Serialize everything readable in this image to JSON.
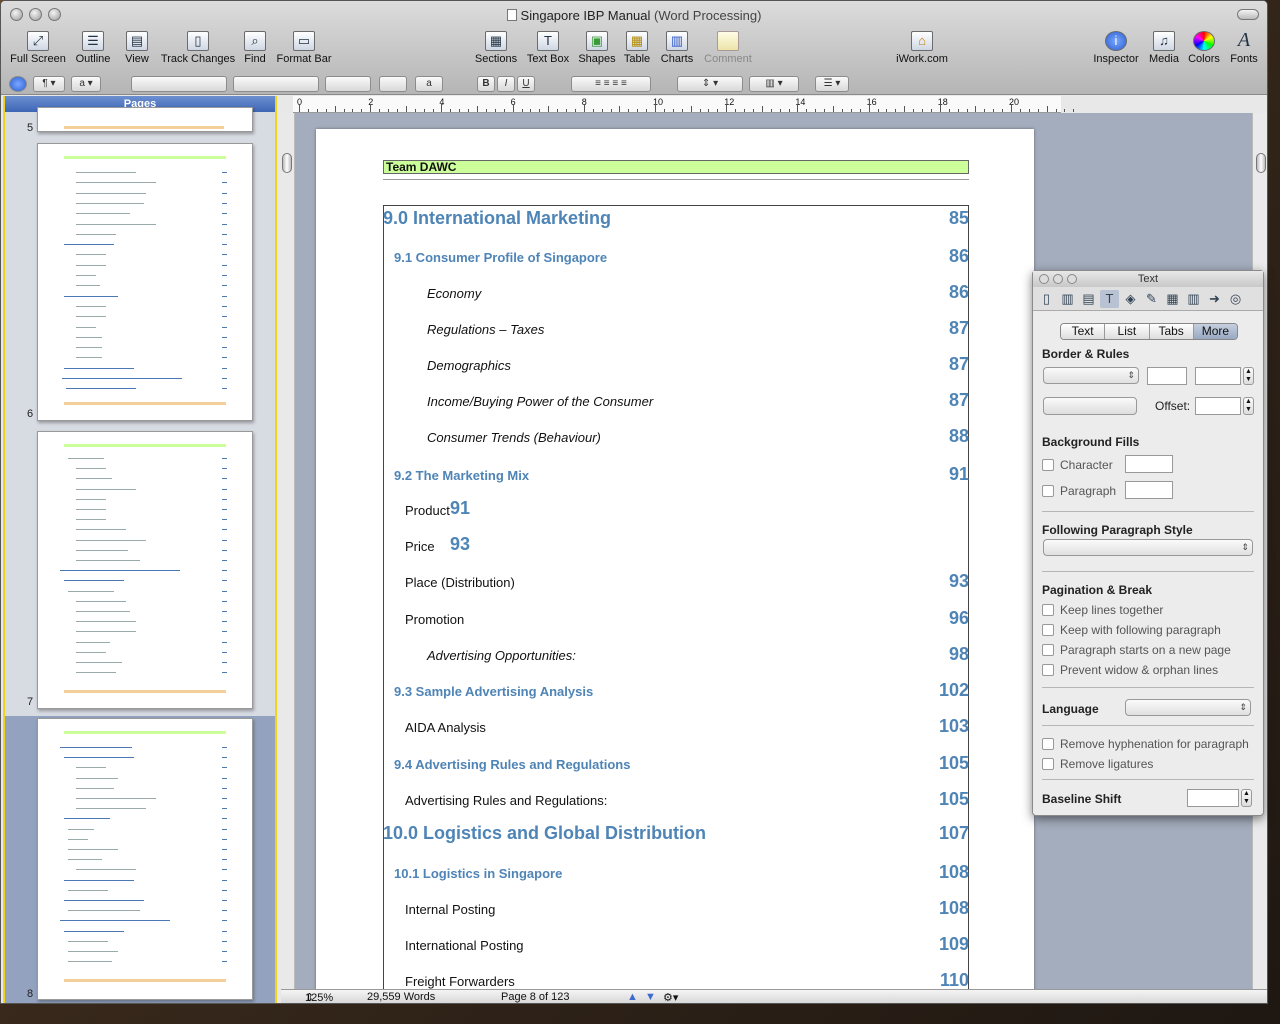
{
  "window": {
    "title": "Singapore IBP Manual",
    "subtitle": "(Word Processing)"
  },
  "toolbar": {
    "left": [
      {
        "label": "Full Screen",
        "icon": "full-screen-icon"
      },
      {
        "label": "Outline",
        "icon": "outline-icon"
      },
      {
        "label": "View",
        "icon": "view-icon"
      },
      {
        "label": "Track Changes",
        "icon": "track-changes-icon"
      },
      {
        "label": "Find",
        "icon": "find-icon"
      },
      {
        "label": "Format Bar",
        "icon": "format-bar-icon"
      }
    ],
    "center": [
      {
        "label": "Sections",
        "icon": "sections-icon"
      },
      {
        "label": "Text Box",
        "icon": "text-box-icon"
      },
      {
        "label": "Shapes",
        "icon": "shapes-icon"
      },
      {
        "label": "Table",
        "icon": "table-icon"
      },
      {
        "label": "Charts",
        "icon": "charts-icon"
      },
      {
        "label": "Comment",
        "icon": "comment-icon"
      }
    ],
    "iwork": {
      "label": "iWork.com",
      "icon": "iwork-icon"
    },
    "right": [
      {
        "label": "Inspector",
        "icon": "inspector-icon"
      },
      {
        "label": "Media",
        "icon": "media-icon"
      },
      {
        "label": "Colors",
        "icon": "colors-icon"
      },
      {
        "label": "Fonts",
        "icon": "fonts-icon"
      }
    ]
  },
  "formatbar": {
    "bold": "B",
    "italic": "I",
    "underline": "U",
    "a_glyph": "a"
  },
  "sidebar": {
    "header": "Pages",
    "page_numbers": [
      "5",
      "6",
      "7",
      "8"
    ]
  },
  "ruler": {
    "ticks": [
      "0",
      "2",
      "4",
      "6",
      "8",
      "10",
      "12",
      "14",
      "16",
      "18",
      "20"
    ]
  },
  "document": {
    "header": "Team DAWC",
    "toc": [
      {
        "level": "h1",
        "label": "9.0 International Marketing",
        "page": "85"
      },
      {
        "level": "h2",
        "label": "9.1 Consumer Profile of Singapore",
        "page": "86"
      },
      {
        "level": "h4",
        "label": "Economy",
        "page": "86"
      },
      {
        "level": "h4",
        "label": "Regulations – Taxes",
        "page": "87"
      },
      {
        "level": "h4",
        "label": "Demographics",
        "page": "87"
      },
      {
        "level": "h4",
        "label": "Income/Buying Power of the Consumer",
        "page": "87"
      },
      {
        "level": "h4",
        "label": "Consumer Trends (Behaviour)",
        "page": "88"
      },
      {
        "level": "h2",
        "label": "9.2 The Marketing Mix",
        "page": "91"
      },
      {
        "level": "h3i",
        "label": "Product",
        "page": "91"
      },
      {
        "level": "h3i",
        "label": "Price",
        "page": "93"
      },
      {
        "level": "h3",
        "label": "Place (Distribution)",
        "page": "93"
      },
      {
        "level": "h3",
        "label": "Promotion",
        "page": "96"
      },
      {
        "level": "h4",
        "label": "Advertising Opportunities:",
        "page": "98"
      },
      {
        "level": "h2",
        "label": "9.3 Sample Advertising Analysis",
        "page": "102"
      },
      {
        "level": "h3",
        "label": "AIDA Analysis",
        "page": "103"
      },
      {
        "level": "h2",
        "label": "9.4 Advertising Rules and Regulations",
        "page": "105"
      },
      {
        "level": "h3",
        "label": "Advertising Rules and Regulations:",
        "page": "105"
      },
      {
        "level": "h1",
        "label": "10.0 Logistics and Global Distribution",
        "page": "107"
      },
      {
        "level": "h2",
        "label": "10.1 Logistics in Singapore",
        "page": "108"
      },
      {
        "level": "h3",
        "label": "Internal Posting",
        "page": "108"
      },
      {
        "level": "h3",
        "label": "International Posting",
        "page": "109"
      },
      {
        "level": "h3",
        "label": "Freight Forwarders",
        "page": "110"
      }
    ]
  },
  "status": {
    "zoom": "125%",
    "words": "29,559 Words",
    "page": "Page 8 of 123"
  },
  "inspector": {
    "title": "Text",
    "tabs": [
      "Text",
      "List",
      "Tabs",
      "More"
    ],
    "border_rules": "Border & Rules",
    "offset": "Offset:",
    "background_fills": "Background Fills",
    "character": "Character",
    "paragraph": "Paragraph",
    "following_style": "Following Paragraph Style",
    "pagination": "Pagination & Break",
    "keep_lines": "Keep lines together",
    "keep_following": "Keep with following paragraph",
    "new_page": "Paragraph starts on a new page",
    "widow": "Prevent widow & orphan lines",
    "language": "Language",
    "hyphenation": "Remove hyphenation for paragraph",
    "ligatures": "Remove ligatures",
    "baseline": "Baseline Shift"
  },
  "colors": {
    "accent": "#4e84b6",
    "header_band": "#ccff99",
    "selection": "#f0d31c"
  }
}
